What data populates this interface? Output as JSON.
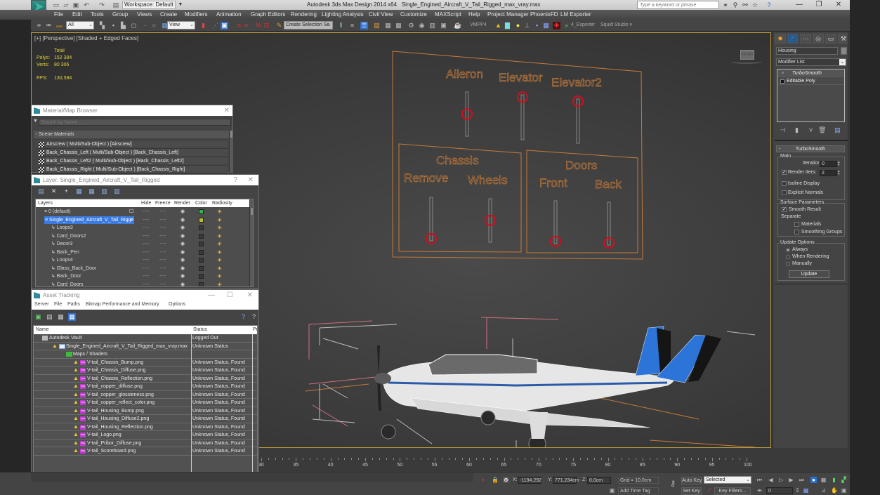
{
  "app": {
    "title": "Autodesk 3ds Max Design 2014 x64",
    "file_name": "Single_Engined_Aircraft_V_Tail_Rigged_max_vray.max",
    "logo_text": "MAX",
    "workspace": "Workspace: Default",
    "help_search_placeholder": "Type a keyword or phrase"
  },
  "menu": [
    "File",
    "Edit",
    "Tools",
    "Group",
    "Views",
    "Create",
    "Modifiers",
    "Animation",
    "Graph Editors",
    "Rendering",
    "Lighting Analysis",
    "Civil View",
    "Customize",
    "MAXScript",
    "Help",
    "Project Manager",
    "PhoenixFD",
    "LM Exporter"
  ],
  "toolbar": {
    "selection_filter": "All",
    "ref_coord": "View",
    "named_selection": "Create Selection Se",
    "vmpp_label": "VMPP4",
    "exporter_label": "4_Exporter",
    "squid_label": "Squid Studio v"
  },
  "viewport": {
    "label": "[+] [Perspective] [Shaded + Edged Faces]",
    "stats": {
      "total_label": "Total",
      "polys_label": "Polys:",
      "polys_value": "152 384",
      "verts_label": "Verts:",
      "verts_value": "80 306",
      "fps_label": "FPS:",
      "fps_value": "130,594"
    },
    "viewcube_label": "FRONT",
    "rig_panel": {
      "top_labels": [
        "Aileron",
        "Elevator",
        "Elevator2"
      ],
      "top_slider_positions": [
        0.5,
        0.05,
        0.05
      ],
      "chassis_title": "Chassis",
      "chassis_labels": [
        "Remove",
        "Wheels"
      ],
      "chassis_slider_positions": [
        0.95,
        0.5
      ],
      "doors_title": "Doors",
      "doors_labels": [
        "Front",
        "Back"
      ],
      "doors_slider_positions": [
        0.95,
        0.95
      ],
      "line_color": "#c47a3a",
      "handle_color": "#cc1020"
    }
  },
  "material_browser": {
    "title": "Material/Map Browser",
    "search_placeholder": "Search by Name ...",
    "section": "Scene Materials",
    "items": [
      "Airscrew ( Multi/Sub-Object ) [Airscrew]",
      "Back_Chassis_Left ( Multi/Sub-Object ) [Back_Chassis_Left]",
      "Back_Chassis_Left2 ( Multi/Sub-Object ) [Back_Chassis_Left2]",
      "Back_Chassis_Right ( Multi/Sub-Object ) [Back_Chassis_Right]"
    ]
  },
  "layer_window": {
    "title": "Layer: Single_Engined_Aircraft_V_Tail_Rigged",
    "columns": [
      "Layers",
      "Hide",
      "Freeze",
      "Render",
      "Color",
      "Radiosity"
    ],
    "rows": [
      {
        "name": "0 (default)",
        "level": 0,
        "color": "#2fb84a",
        "selected": false,
        "hide": "----",
        "freeze": "----"
      },
      {
        "name": "Single_Engined_Aircraft_V_Tail_Rigge",
        "level": 0,
        "color": "#b8c020",
        "selected": true,
        "hide": "----",
        "freeze": "----"
      },
      {
        "name": "Loops3",
        "level": 1,
        "color": "#3a3a3a",
        "selected": false,
        "hide": "----",
        "freeze": "----"
      },
      {
        "name": "Card_Doors2",
        "level": 1,
        "color": "#3a3a3a",
        "selected": false,
        "hide": "----",
        "freeze": "----"
      },
      {
        "name": "Decor3",
        "level": 1,
        "color": "#3a3a3a",
        "selected": false,
        "hide": "----",
        "freeze": "----"
      },
      {
        "name": "Back_Pen",
        "level": 1,
        "color": "#3a3a3a",
        "selected": false,
        "hide": "----",
        "freeze": "----"
      },
      {
        "name": "Loops4",
        "level": 1,
        "color": "#3a3a3a",
        "selected": false,
        "hide": "----",
        "freeze": "----"
      },
      {
        "name": "Glass_Back_Door",
        "level": 1,
        "color": "#3a3a3a",
        "selected": false,
        "hide": "----",
        "freeze": "----"
      },
      {
        "name": "Back_Door",
        "level": 1,
        "color": "#3a3a3a",
        "selected": false,
        "hide": "----",
        "freeze": "----"
      },
      {
        "name": "Card_Doors",
        "level": 1,
        "color": "#3a3a3a",
        "selected": false,
        "hide": "----",
        "freeze": "----"
      }
    ]
  },
  "asset_tracking": {
    "title": "Asset Tracking",
    "menu": [
      "Server",
      "File",
      "Paths",
      "Bitmap Performance and Memory",
      "Options"
    ],
    "columns": [
      "Name",
      "Status",
      "Pr"
    ],
    "rows": [
      {
        "name": "Autodesk Vault",
        "status": "Logged Out",
        "level": 0,
        "icon": "vault"
      },
      {
        "name": "Single_Engined_Aircraft_V_Tail_Rigged_max_vray.max",
        "status": "Unknown Status",
        "level": 1,
        "icon": "max-file"
      },
      {
        "name": "Maps / Shaders",
        "status": "",
        "level": 2,
        "icon": "folder"
      },
      {
        "name": "V-tail_Chassis_Bump.png",
        "status": "Unknown Status, Found",
        "level": 3,
        "icon": "png"
      },
      {
        "name": "V-tail_Chassis_Diffuse.png",
        "status": "Unknown Status, Found",
        "level": 3,
        "icon": "png"
      },
      {
        "name": "V-tail_Chassis_Reflection.png",
        "status": "Unknown Status, Found",
        "level": 3,
        "icon": "png"
      },
      {
        "name": "V-tail_copper_diffuse.png",
        "status": "Unknown Status, Found",
        "level": 3,
        "icon": "png"
      },
      {
        "name": "V-tail_copper_glossieness.png",
        "status": "Unknown Status, Found",
        "level": 3,
        "icon": "png"
      },
      {
        "name": "V-tail_copper_reflect_color.png",
        "status": "Unknown Status, Found",
        "level": 3,
        "icon": "png"
      },
      {
        "name": "V-tail_Housing_Bump.png",
        "status": "Unknown Status, Found",
        "level": 3,
        "icon": "png"
      },
      {
        "name": "V-tail_Housing_Diffuse2.png",
        "status": "Unknown Status, Found",
        "level": 3,
        "icon": "png"
      },
      {
        "name": "V-tail_Housing_Reflection.png",
        "status": "Unknown Status, Found",
        "level": 3,
        "icon": "png"
      },
      {
        "name": "V-tail_Logo.png",
        "status": "Unknown Status, Found",
        "level": 3,
        "icon": "png"
      },
      {
        "name": "V-tail_Pribor_Diffuse.png",
        "status": "Unknown Status, Found",
        "level": 3,
        "icon": "png"
      },
      {
        "name": "V-tail_Scoreboard.png",
        "status": "Unknown Status, Found",
        "level": 3,
        "icon": "png"
      }
    ]
  },
  "command_panel": {
    "object_name": "Housing",
    "modifier_list": "Modifier List",
    "stack": [
      "TurboSmooth",
      "Editable Poly"
    ],
    "rollout_title": "TurboSmooth",
    "main_group": "Main",
    "iterations_label": "Iterations:",
    "iterations_value": "0",
    "render_iters_label": "Render Iters:",
    "render_iters_value": "2",
    "render_iters_checked": true,
    "isoline_label": "Isoline Display",
    "isoline_checked": false,
    "explicit_normals_label": "Explicit Normals",
    "explicit_normals_checked": false,
    "surface_group": "Surface Parameters",
    "smooth_result_label": "Smooth Result",
    "smooth_result_checked": true,
    "separate_label": "Separate",
    "materials_label": "Materials",
    "materials_checked": false,
    "smoothing_groups_label": "Smoothing Groups",
    "smoothing_groups_checked": false,
    "update_group": "Update Options",
    "update_options": [
      "Always",
      "When Rendering",
      "Manually"
    ],
    "update_selected": "Always",
    "update_button": "Update"
  },
  "timeline": {
    "ticks": [
      30,
      35,
      40,
      45,
      50,
      55,
      60,
      65,
      70,
      75,
      80,
      85,
      90,
      95,
      100
    ]
  },
  "status_bar": {
    "x_label": "X:",
    "x_value": "-1194,292",
    "y_label": "Y:",
    "y_value": "771,234cm",
    "z_label": "Z:",
    "z_value": "0,0cm",
    "grid": "Grid = 10,0cm",
    "add_time_tag": "Add Time Tag",
    "auto_key": "Auto Key",
    "set_key": "Set Key",
    "key_mode": "Selected",
    "key_filters": "Key Filters...",
    "current_frame": "0"
  }
}
